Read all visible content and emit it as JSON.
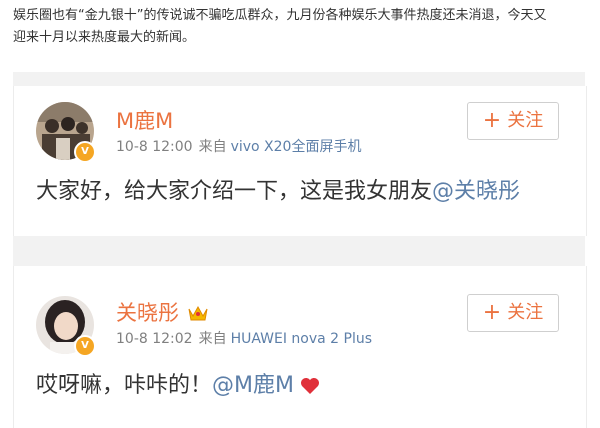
{
  "intro": {
    "line1": "娱乐圈也有“金九银十”的传说诚不骗吃瓜群众，九月份各种娱乐大事件热度还未消退，今天又",
    "line2": "迎来十月以来热度最大的新闻。"
  },
  "posts": [
    {
      "username": "M鹿M",
      "time": "10-8 12:00",
      "source_prefix": "来自",
      "device": "vivo X20全面屏手机",
      "follow_label": "关注",
      "text_before": "大家好，给大家介绍一下，这是我女朋友",
      "mention": "@关晓彤"
    },
    {
      "username": "关晓彤",
      "time": "10-8 12:02",
      "source_prefix": "来自",
      "device": "HUAWEI nova 2 Plus",
      "follow_label": "关注",
      "text_before": "哎呀嘛，咔咔的！",
      "mention": "@M鹿M"
    }
  ],
  "icons": {
    "verified_badge": "verified-v-icon",
    "crown": "crown-vip-icon",
    "heart": "heart-icon",
    "plus": "plus-icon"
  },
  "colors": {
    "name": "#eb7340",
    "mention": "#5d7fa8",
    "badge": "#f5a623",
    "heart": "#e0303a"
  }
}
